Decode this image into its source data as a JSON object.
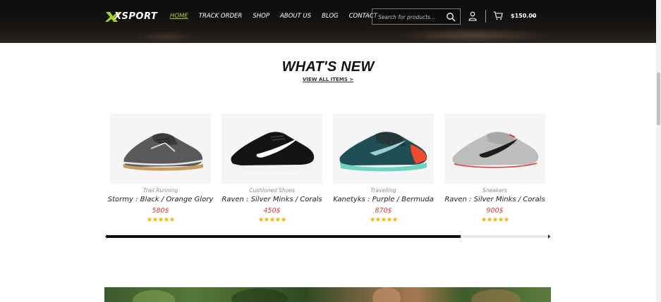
{
  "header": {
    "logo_text": "XSPORT",
    "accent_color": "#a7d129",
    "nav": [
      {
        "label": "HOME",
        "active": true
      },
      {
        "label": "TRACK ORDER",
        "active": false
      },
      {
        "label": "SHOP",
        "active": false
      },
      {
        "label": "ABOUT US",
        "active": false
      },
      {
        "label": "BLOG",
        "active": false
      },
      {
        "label": "CONTACT",
        "active": false
      }
    ],
    "search": {
      "placeholder": "Search for products...",
      "value": ""
    },
    "cart_total": "$150.00"
  },
  "section": {
    "title": "WHAT'S NEW",
    "view_all": "VIEW ALL ITEMS >"
  },
  "products": [
    {
      "category": "Trail Running",
      "name": "Stormy : Black / Orange Glory",
      "price": "580$",
      "rating": 5
    },
    {
      "category": "Cushioned Shoes",
      "name": "Raven : Silver Minks / Corals",
      "price": "450$",
      "rating": 5
    },
    {
      "category": "Travelling",
      "name": "Kanetyks : Purple / Bermuda",
      "price": "870$",
      "rating": 5
    },
    {
      "category": "Sneakers",
      "name": "Raven : Silver Minks / Corals",
      "price": "900$",
      "rating": 5
    }
  ],
  "carousel": {
    "scroll_fraction": 0.8
  },
  "colors": {
    "price": "#d93b3b",
    "star": "#f0b21f"
  }
}
